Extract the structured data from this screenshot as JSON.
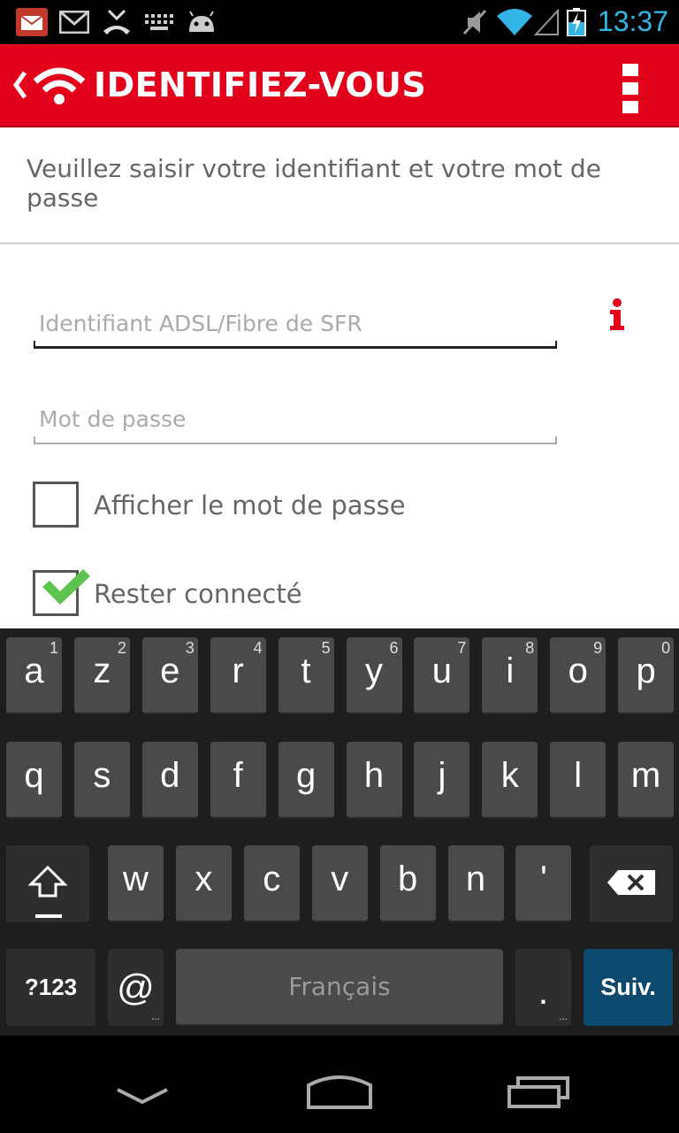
{
  "status_bar": {
    "time": "13:37",
    "icons": [
      "sfr-app-icon",
      "gmail-icon",
      "missed-call-icon",
      "keyboard-icon",
      "android-icon",
      "mute-icon",
      "wifi-icon",
      "signal-icon",
      "battery-charging-icon"
    ]
  },
  "app_bar": {
    "title": "IDENTIFIEZ-VOUS",
    "back_icon": "chevron-left-icon",
    "logo_icon": "wifi-logo-icon",
    "menu_icon": "overflow-menu-icon"
  },
  "form": {
    "instructions": "Veuillez saisir votre identifiant et votre mot de passe",
    "username_placeholder": "Identifiant ADSL/Fibre de SFR",
    "password_placeholder": "Mot de passe",
    "info_icon": "info-icon",
    "show_password_label": "Afficher le mot de passe",
    "show_password_checked": false,
    "stay_connected_label": "Rester connecté",
    "stay_connected_checked": true
  },
  "keyboard": {
    "row1": [
      {
        "key": "a",
        "hint": "1"
      },
      {
        "key": "z",
        "hint": "2"
      },
      {
        "key": "e",
        "hint": "3"
      },
      {
        "key": "r",
        "hint": "4"
      },
      {
        "key": "t",
        "hint": "5"
      },
      {
        "key": "y",
        "hint": "6"
      },
      {
        "key": "u",
        "hint": "7"
      },
      {
        "key": "i",
        "hint": "8"
      },
      {
        "key": "o",
        "hint": "9"
      },
      {
        "key": "p",
        "hint": "0"
      }
    ],
    "row2": [
      "q",
      "s",
      "d",
      "f",
      "g",
      "h",
      "j",
      "k",
      "l",
      "m"
    ],
    "row3": [
      "w",
      "x",
      "c",
      "v",
      "b",
      "n",
      "'"
    ],
    "symbols_label": "?123",
    "at_label": "@",
    "space_label": "Français",
    "period_label": ".",
    "action_label": "Suiv.",
    "shift_icon": "shift-icon",
    "delete_icon": "backspace-icon",
    "action_color": "#0b4a6e"
  },
  "nav_bar": {
    "icons": [
      "back-chevron-icon",
      "home-icon",
      "recent-apps-icon"
    ]
  },
  "colors": {
    "brand_red": "#e2001a",
    "check_green": "#5cc44f",
    "time_blue": "#33b5e5"
  }
}
